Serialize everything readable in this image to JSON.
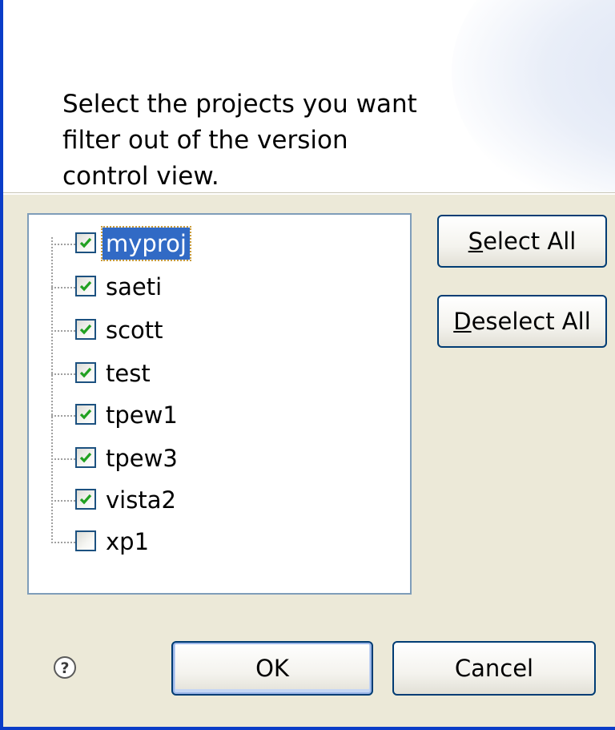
{
  "header": {
    "message": "Select the projects you want\nfilter out of the version\ncontrol view."
  },
  "projects": [
    {
      "label": "myproj",
      "checked": true,
      "selected": true
    },
    {
      "label": "saeti",
      "checked": true,
      "selected": false
    },
    {
      "label": "scott",
      "checked": true,
      "selected": false
    },
    {
      "label": "test",
      "checked": true,
      "selected": false
    },
    {
      "label": "tpew1",
      "checked": true,
      "selected": false
    },
    {
      "label": "tpew3",
      "checked": true,
      "selected": false
    },
    {
      "label": "vista2",
      "checked": true,
      "selected": false
    },
    {
      "label": "xp1",
      "checked": false,
      "selected": false
    }
  ],
  "buttons": {
    "select_all": {
      "mnemonic": "S",
      "rest": "elect All"
    },
    "deselect_all": {
      "mnemonic": "D",
      "rest": "eselect All"
    },
    "ok": "OK",
    "cancel": "Cancel"
  },
  "icons": {
    "help": "help-icon",
    "checkmark": "checkmark-icon"
  },
  "colors": {
    "accent": "#316ac5",
    "check": "#21a121",
    "window_border": "#0a3cc8"
  }
}
